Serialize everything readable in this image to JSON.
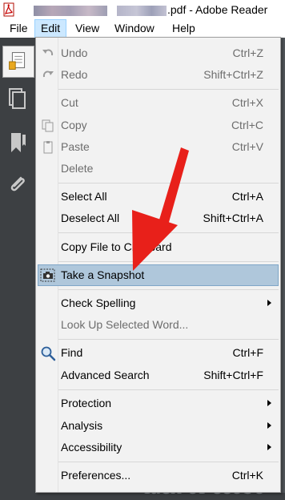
{
  "window": {
    "title": ".pdf - Adobe Reader"
  },
  "menubar": {
    "items": [
      "File",
      "Edit",
      "View",
      "Window",
      "Help"
    ],
    "active": "Edit"
  },
  "edit_menu": {
    "undo": {
      "label": "Undo",
      "shortcut": "Ctrl+Z",
      "mnemonic": "U"
    },
    "redo": {
      "label": "Redo",
      "shortcut": "Shift+Ctrl+Z",
      "mnemonic": "R"
    },
    "cut": {
      "label": "Cut",
      "shortcut": "Ctrl+X"
    },
    "copy": {
      "label": "Copy",
      "shortcut": "Ctrl+C"
    },
    "paste": {
      "label": "Paste",
      "shortcut": "Ctrl+V"
    },
    "delete": {
      "label": "Delete"
    },
    "select_all": {
      "label": "Select All",
      "shortcut": "Ctrl+A"
    },
    "deselect_all": {
      "label": "Deselect All",
      "shortcut": "Shift+Ctrl+A"
    },
    "copy_file": {
      "label": "Copy File to Clipboard"
    },
    "snapshot": {
      "label": "Take a Snapshot"
    },
    "check_spelling": {
      "label": "Check Spelling"
    },
    "look_up": {
      "label": "Look Up Selected Word..."
    },
    "find": {
      "label": "Find",
      "shortcut": "Ctrl+F"
    },
    "advanced_search": {
      "label": "Advanced Search",
      "shortcut": "Shift+Ctrl+F"
    },
    "protection": {
      "label": "Protection"
    },
    "analysis": {
      "label": "Analysis"
    },
    "accessibility": {
      "label": "Accessibility"
    },
    "preferences": {
      "label": "Preferences...",
      "shortcut": "Ctrl+K"
    }
  },
  "colors": {
    "menu_bg": "#f2f2f2",
    "highlight": "#afc7db",
    "active_menu": "#cce8ff",
    "annotation_arrow": "#e8201a",
    "disabled_text": "#6d6d6d"
  },
  "icons": [
    "pdf-app-icon",
    "undo-icon",
    "redo-icon",
    "copy-icon",
    "paste-icon",
    "camera-icon",
    "find-icon",
    "pages-icon",
    "bookmark-icon",
    "attachment-icon",
    "submenu-arrow-icon"
  ]
}
